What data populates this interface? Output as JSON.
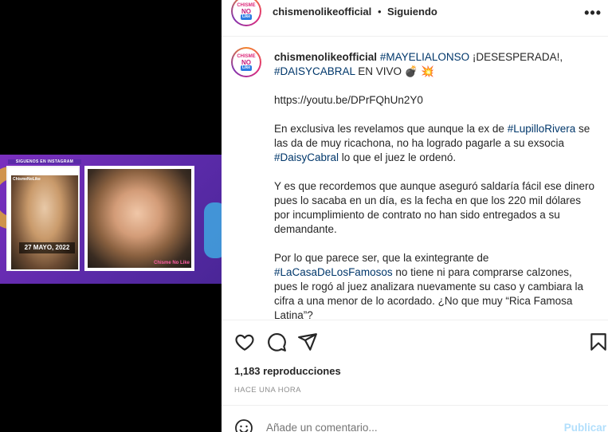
{
  "media": {
    "small_card_header": "SIGUENOS EN INSTAGRAM",
    "small_card_handle": "ChismeNoLike",
    "small_card_date": "27 MAYO, 2022",
    "big_card_tag": "Chisme No Like"
  },
  "header": {
    "username": "chismenolikeofficial",
    "separator": "•",
    "follow_status": "Siguiendo",
    "more_icon": "more-horizontal-icon"
  },
  "avatar": {
    "line1": "CHISME",
    "line2": "NO",
    "line3": "Like"
  },
  "caption": {
    "username": "chismenolikeofficial",
    "hashtag1": "#MAYELIALONSO",
    "text1": " ¡DESESPERADA!, ",
    "hashtag2": "#DAISYCABRAL",
    "text2": " EN VIVO 💣 💥",
    "url": "https://youtu.be/DPrFQhUn2Y0",
    "p2_a": "En exclusiva les revelamos que aunque la ex de ",
    "p2_tag1": "#LupilloRivera",
    "p2_b": " se las da de muy ricachona, no ha logrado pagarle a su exsocia ",
    "p2_tag2": "#DaisyCabral",
    "p2_c": " lo que el juez le ordenó.",
    "p3": "Y es que recordemos que aunque aseguró saldaría fácil ese dinero pues lo sacaba en un día, es la fecha en que los 220 mil dólares por incumplimiento de contrato no han sido entregados a su demandante.",
    "p4_a": "Por lo que parece ser, que la exintegrante de ",
    "p4_tag": "#LaCasaDeLosFamosos",
    "p4_b": " no tiene ni para comprarse calzones, pues le rogó al juez analizara nuevamente su caso y cambiara la cifra a una menor de lo acordado. ¿No que muy “Rica Famosa Latina”?"
  },
  "actions": {
    "like_icon": "heart-icon",
    "comment_icon": "comment-icon",
    "share_icon": "send-icon",
    "save_icon": "bookmark-icon"
  },
  "stats": {
    "views": "1,183 reproducciones",
    "time_ago": "HACE UNA HORA"
  },
  "comment": {
    "emoji_icon": "emoji-icon",
    "placeholder": "Añade un comentario...",
    "publish_label": "Publicar"
  }
}
